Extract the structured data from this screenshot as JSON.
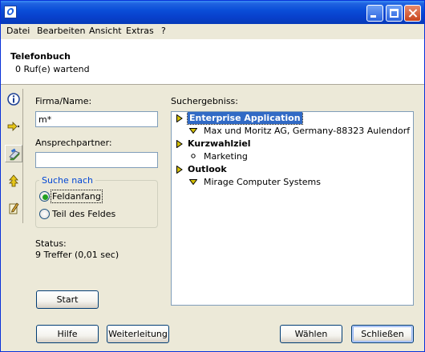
{
  "menubar": {
    "items": [
      "Datei",
      "Bearbeiten",
      "Ansicht",
      "Extras",
      "?"
    ]
  },
  "header": {
    "title": "Telefonbuch",
    "status": "0 Ruf(e) wartend"
  },
  "toolbar": {
    "icons": [
      "info-icon",
      "forward-arrow-icon",
      "phonebook-icon",
      "up-arrows-icon",
      "notepad-icon"
    ]
  },
  "form": {
    "company_label": "Firma/Name:",
    "company_value": "m*",
    "contact_label": "Ansprechpartner:",
    "contact_value": "",
    "search_group_label": "Suche nach",
    "options": [
      "Feldanfang",
      "Teil des Feldes"
    ],
    "selected_option": "Feldanfang",
    "status_label": "Status:",
    "status_value": "9 Treffer (0,01 sec)",
    "start_label": "Start"
  },
  "results": {
    "label": "Suchergebniss:",
    "groups": [
      {
        "name": "Enterprise Application",
        "selected": true,
        "items": [
          {
            "text": "Max und Moritz AG, Germany-88323 Aulendorf",
            "icon": "contact-arrow-icon"
          }
        ]
      },
      {
        "name": "Kurzwahlziel",
        "selected": false,
        "items": [
          {
            "text": "Marketing",
            "icon": "bullet-icon"
          }
        ]
      },
      {
        "name": "Outlook",
        "selected": false,
        "items": [
          {
            "text": "Mirage Computer Systems",
            "icon": "contact-arrow-icon"
          }
        ]
      }
    ]
  },
  "buttons": {
    "help": "Hilfe",
    "forward": "Weiterleitung",
    "dial": "Wählen",
    "close": "Schließen"
  },
  "colors": {
    "titlebar": "#0a4ed8",
    "selection": "#316ac5",
    "group_caption": "#0046d5",
    "tree_arrow": "#d4c000"
  }
}
